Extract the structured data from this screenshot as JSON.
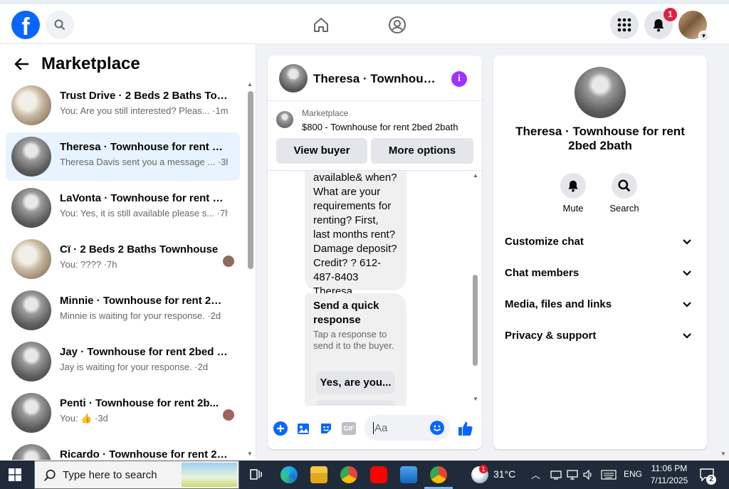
{
  "topbar": {
    "logo": "f",
    "notification_count": "1",
    "icons": [
      "facebook-logo",
      "search-icon",
      "home-icon",
      "groups-icon",
      "menu-grid-icon",
      "bell-icon",
      "profile-avatar"
    ]
  },
  "sidebar": {
    "title": "Marketplace",
    "conversations": [
      {
        "name": "Trust Drive · 2 Beds 2 Baths Tow...",
        "snippet": "You: Are you still interested? Pleas... ·1m",
        "active": false
      },
      {
        "name": "Theresa · Townhouse for rent 2b...",
        "snippet": "Theresa Davis sent you a message ... ·3h",
        "active": true
      },
      {
        "name": "LaVonta · Townhouse for rent 2b...",
        "snippet": "You: Yes, it is still available please s... ·7h",
        "active": false
      },
      {
        "name": "Cï · 2 Beds 2 Baths Townhouse",
        "snippet": "You: ???? ·7h",
        "active": false
      },
      {
        "name": "Minnie · Townhouse for rent 2be...",
        "snippet": "Minnie is waiting for your response. ·2d",
        "active": false
      },
      {
        "name": "Jay · Townhouse for rent 2bed 2...",
        "snippet": "Jay is waiting for your response. ·2d",
        "active": false
      },
      {
        "name": "Penti · Townhouse for rent 2b...",
        "snippet": "You: 👍 ·3d",
        "active": false
      },
      {
        "name": "Ricardo · Townhouse for rent 2b...",
        "snippet": "",
        "active": false
      }
    ]
  },
  "chat": {
    "title": "Theresa · Townhouse for rent 2bed 2bath",
    "listing_source": "Marketplace",
    "listing_desc": "$800 - Townhouse for rent 2bed 2bath",
    "view_buyer": "View buyer",
    "more_options": "More options",
    "message": "available& when? What are your requirements for renting? First, last months rent? Damage deposit? Credit? ? 612-487-8403 Theresa",
    "quick_title": "Send a quick response",
    "quick_sub": "Tap a response to send it to the buyer.",
    "quick_reply": "Yes, are you...",
    "composer_placeholder": "Aa",
    "gif": "GIF"
  },
  "info": {
    "title": "Theresa · Townhouse for rent 2bed 2bath",
    "mute": "Mute",
    "search": "Search",
    "rows": [
      "Customize chat",
      "Chat members",
      "Media, files and links",
      "Privacy & support"
    ]
  },
  "taskbar": {
    "search_placeholder": "Type here to search",
    "weather": "31°C",
    "weather_badge": "1",
    "language": "ENG",
    "time": "11:06 PM",
    "date": "7/11/2025",
    "notifications": "2"
  },
  "colors": {
    "brand": "#0866ff",
    "active_row": "#e7f3ff",
    "badge": "#e41e3f",
    "info_accent": "#a033ff"
  }
}
